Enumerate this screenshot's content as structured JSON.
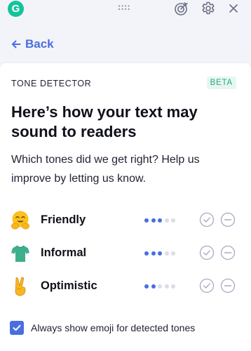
{
  "header": {
    "logo_letter": "G",
    "icons": [
      "grammarly-logo",
      "drag-handle-icon",
      "goals-target-icon",
      "gear-icon",
      "close-icon"
    ]
  },
  "nav": {
    "back_label": "Back"
  },
  "panel": {
    "label": "TONE DETECTOR",
    "badge": "BETA",
    "headline": "Here’s how your text may sound to readers",
    "subtext": "Which tones did we get right? Help us improve by letting us know."
  },
  "tones": [
    {
      "name": "Friendly",
      "emoji": "hugging-face",
      "level": 3,
      "max": 5
    },
    {
      "name": "Informal",
      "emoji": "t-shirt",
      "level": 3,
      "max": 5
    },
    {
      "name": "Optimistic",
      "emoji": "victory-hand",
      "level": 2,
      "max": 5
    }
  ],
  "settings": {
    "always_show_emoji_label": "Always show emoji for detected tones",
    "always_show_emoji_checked": true
  },
  "colors": {
    "brand": "#15c39a",
    "accent": "#4a6ee0",
    "dot_active": "#4a6ee0",
    "dot_inactive": "#dadde6",
    "beta_bg": "#e6f7f1",
    "beta_text": "#2aa877",
    "background": "#f3f4f9"
  }
}
